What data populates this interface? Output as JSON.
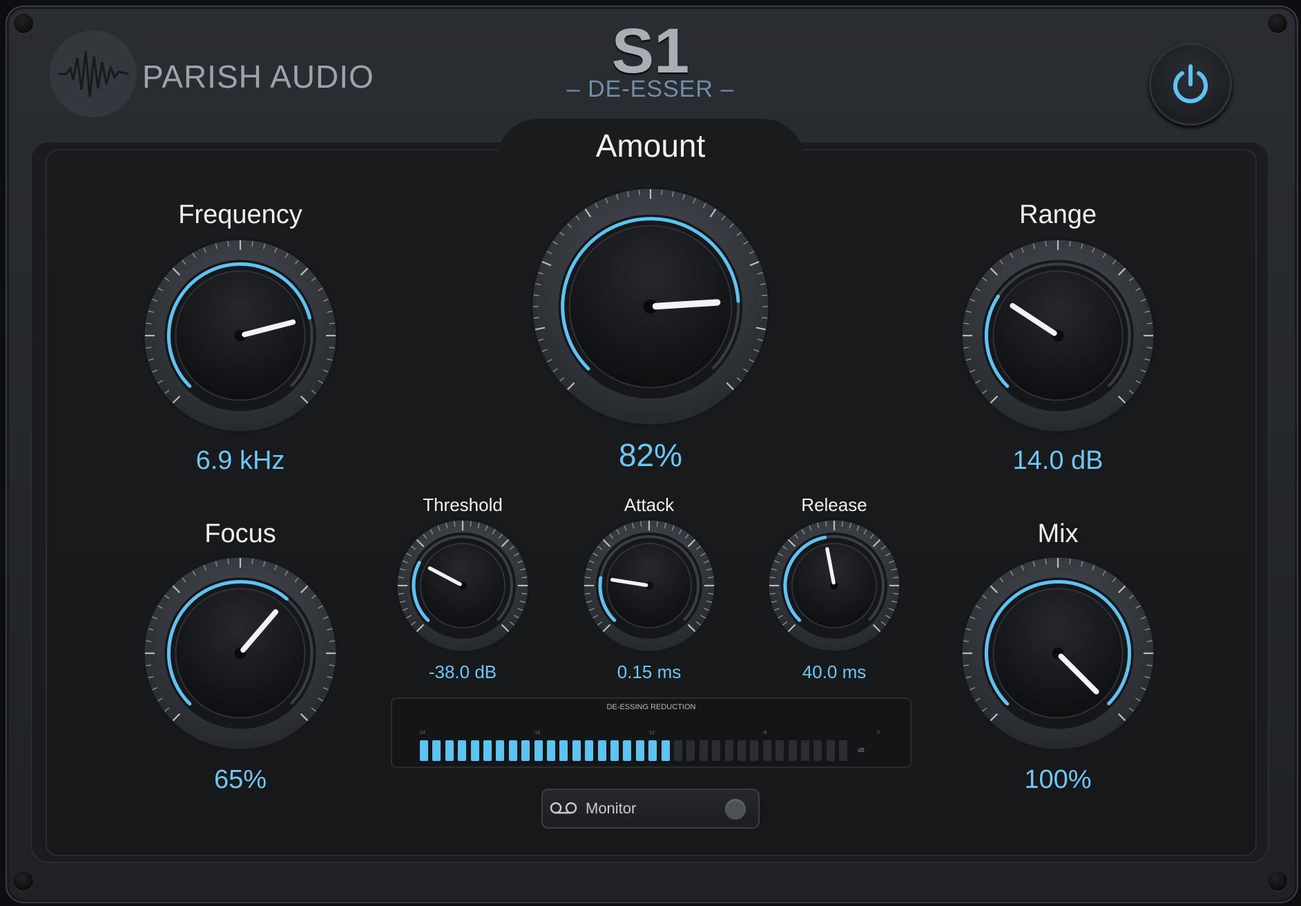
{
  "brand": {
    "name": "PARISH AUDIO",
    "logo_icon": "waveform-icon"
  },
  "product": {
    "title": "S1",
    "subtitle": "– DE-ESSER –"
  },
  "power": {
    "icon": "power-icon",
    "state": "on"
  },
  "accent_color": "#5ec3f0",
  "knobs": {
    "amount": {
      "label": "Amount",
      "value": "82%",
      "level": 0.82
    },
    "frequency": {
      "label": "Frequency",
      "value": "6.9 kHz",
      "level": 0.78
    },
    "range": {
      "label": "Range",
      "value": "14.0 dB",
      "level": 0.29
    },
    "focus": {
      "label": "Focus",
      "value": "65%",
      "level": 0.65
    },
    "mix": {
      "label": "Mix",
      "value": "100%",
      "level": 1.0
    },
    "threshold": {
      "label": "Threshold",
      "value": "-38.0 dB",
      "level": 0.27
    },
    "attack": {
      "label": "Attack",
      "value": "0.15 ms",
      "level": 0.2
    },
    "release": {
      "label": "Release",
      "value": "40.0 ms",
      "level": 0.46
    }
  },
  "meter": {
    "title": "DE-ESSING REDUCTION",
    "tick_labels": [
      "-24",
      "-18",
      "-12",
      "-6",
      "0"
    ],
    "unit": "dB",
    "lit_segments": 20,
    "total_segments": 34,
    "lit_color": "#5ec3f0",
    "unlit_color": "#2b2d31"
  },
  "monitor": {
    "label": "Monitor",
    "icon": "headphones-icon",
    "state": "off"
  }
}
